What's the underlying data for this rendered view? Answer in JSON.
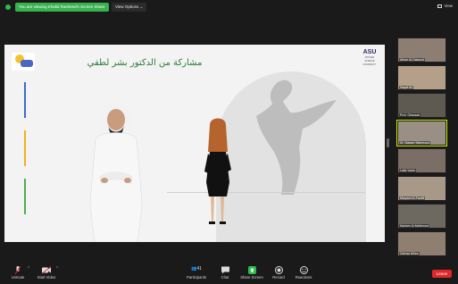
{
  "topbar": {
    "share_banner": "You are viewing Khalid Rasheed's Screen Share",
    "view_options": "View Options ⌄",
    "view_label": "View"
  },
  "slide": {
    "title": "مشاركة من الدكتور بشر لطفي",
    "logo_right": "ASU",
    "logo_right_sub": "APPLIED SCIENCE UNIVERSITY",
    "bar_colors": [
      "#3b6cc9",
      "#f2b01e",
      "#4caf50"
    ]
  },
  "participants": [
    {
      "name": "Afnan Al-Dawoud"
    },
    {
      "name": "Hayat Ali"
    },
    {
      "name": "Prof. Ghassan"
    },
    {
      "name": "Dr. Nasser Mahmoud"
    },
    {
      "name": "Laila Yasin"
    },
    {
      "name": "Maryam Al-Fadhli"
    },
    {
      "name": "Mariam Al-Mahmood"
    },
    {
      "name": "Zahraa Mirza"
    }
  ],
  "controls": {
    "unmute": "Unmute",
    "start_video": "Start Video",
    "participants": "Participants",
    "participants_count": "41",
    "chat": "Chat",
    "share_screen": "Share Screen",
    "record": "Record",
    "reactions": "Reactions",
    "leave": "Leave"
  },
  "colors": {
    "accent_green": "#2dbb4b",
    "leave_red": "#e02828",
    "active_border": "#c6f000",
    "title_green": "#2b7a3a"
  }
}
